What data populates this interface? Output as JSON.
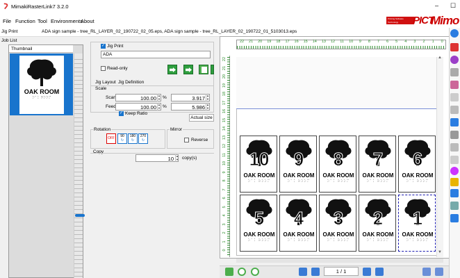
{
  "app": {
    "title": "MimakiRasterLink7 3.2.0"
  },
  "menu": {
    "items": [
      "File",
      "Function",
      "Tool",
      "Environments",
      "About"
    ]
  },
  "brand": {
    "small_text": "Printing Software Technology",
    "pict": "PICT",
    "mimo": "Mimo"
  },
  "jig": {
    "label": "Jig Print",
    "files": "ADA sign sample - tree_RL_LAYER_02_190722_02_05.eps, ADA sign sample - tree_RL_LAYER_02_190722_01_5103013.eps"
  },
  "joblist": {
    "label": "Job List",
    "thumbnail_header": "Thumbnail",
    "thumb_title": "OAK ROOM",
    "thumb_braille": "⠕⠁⠅ ⠗⠕⠕⠍"
  },
  "jig_print": {
    "checkbox_label": "Jig Print",
    "name_value": "ADA",
    "read_only_label": "Read-only"
  },
  "tabs": {
    "layout": "Jig Layout",
    "definition": "Jig Definition"
  },
  "scale": {
    "label": "Scale",
    "scan_label": "Scan",
    "scan_value": "100.00",
    "scan_unit": "%",
    "scan_size": "3.917",
    "feed_label": "Feed",
    "feed_value": "100.00",
    "feed_unit": "%",
    "feed_size": "5.986",
    "keep_ratio_label": "Keep Ratio",
    "actual_size_label": "Actual size"
  },
  "rotation": {
    "label": "Rotation",
    "off": "OFF",
    "r90": "90",
    "r180": "180",
    "r270": "270"
  },
  "mirror": {
    "label": "Mirror",
    "reverse_label": "Reverse"
  },
  "copy": {
    "label": "Copy",
    "value": "10",
    "unit": "copy(s)"
  },
  "ruler": {
    "top": [
      "22",
      "21",
      "20",
      "19",
      "18",
      "17",
      "16",
      "15",
      "14",
      "13",
      "12",
      "11",
      "10",
      "9",
      "8",
      "7",
      "6",
      "5",
      "4",
      "3",
      "2",
      "1",
      "0"
    ],
    "left": [
      "22",
      "21",
      "20",
      "19",
      "18",
      "17",
      "16",
      "15",
      "14",
      "13",
      "12",
      "11",
      "10",
      "9",
      "8",
      "7",
      "6",
      "5",
      "4",
      "3",
      "2",
      "1",
      "0"
    ]
  },
  "cards": [
    {
      "num": "10",
      "title": "OAK ROOM",
      "braille": "⠕⠁⠅ ⠗⠕⠕⠍"
    },
    {
      "num": "9",
      "title": "OAK ROOM",
      "braille": "⠕⠁⠅ ⠗⠕⠕⠍"
    },
    {
      "num": "8",
      "title": "OAK ROOM",
      "braille": "⠕⠁⠅ ⠗⠕⠕⠍"
    },
    {
      "num": "7",
      "title": "OAK ROOM",
      "braille": "⠕⠁⠅ ⠗⠕⠕⠍"
    },
    {
      "num": "6",
      "title": "OAK ROOM",
      "braille": "⠕⠁⠅ ⠗⠕⠕⠍"
    },
    {
      "num": "5",
      "title": "OAK ROOM",
      "braille": "⠕⠁⠅ ⠗⠕⠕⠍"
    },
    {
      "num": "4",
      "title": "OAK ROOM",
      "braille": "⠕⠁⠅ ⠗⠕⠕⠍"
    },
    {
      "num": "3",
      "title": "OAK ROOM",
      "braille": "⠕⠁⠅ ⠗⠕⠕⠍"
    },
    {
      "num": "2",
      "title": "OAK ROOM",
      "braille": "⠕⠁⠅ ⠗⠕⠕⠍"
    },
    {
      "num": "1",
      "title": "OAK ROOM",
      "braille": "⠕⠁⠅ ⠗⠕⠕⠍"
    }
  ],
  "pager": {
    "text": "1 / 1"
  },
  "colors": {
    "accent": "#1874cd",
    "green": "#2e9e3e",
    "brand_red": "#c00000",
    "ruler_green": "#2a8a2a"
  }
}
